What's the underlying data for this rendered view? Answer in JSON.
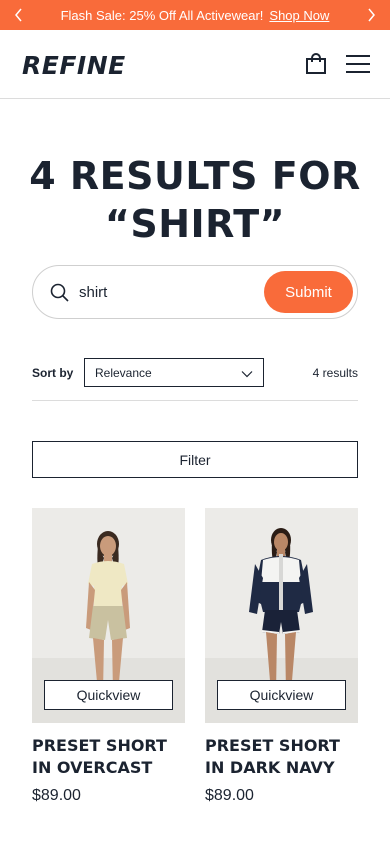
{
  "promo": {
    "message": "Flash Sale: 25% Off All Activewear!",
    "link": "Shop Now"
  },
  "header": {
    "logo": "REFINE",
    "icons": [
      "chevron-left-icon",
      "chevron-right-icon",
      "shopping-bag-icon",
      "hamburger-menu-icon"
    ]
  },
  "results": {
    "title_line1": "4 RESULTS FOR",
    "title_line2": "“SHIRT”"
  },
  "search": {
    "value": "shirt",
    "submit_label": "Submit"
  },
  "sort": {
    "label": "Sort by",
    "selected": "Relevance",
    "count": "4 results"
  },
  "filter_label": "Filter",
  "products": [
    {
      "name": "PRESET SHORT IN OVERCAST",
      "price": "$89.00",
      "quickview": "Quickview"
    },
    {
      "name": "PRESET SHORT IN DARK NAVY",
      "price": "$89.00",
      "quickview": "Quickview"
    }
  ],
  "colors": {
    "accent": "#f96b3a",
    "text": "#1b2330",
    "border": "#dcdcdc"
  }
}
